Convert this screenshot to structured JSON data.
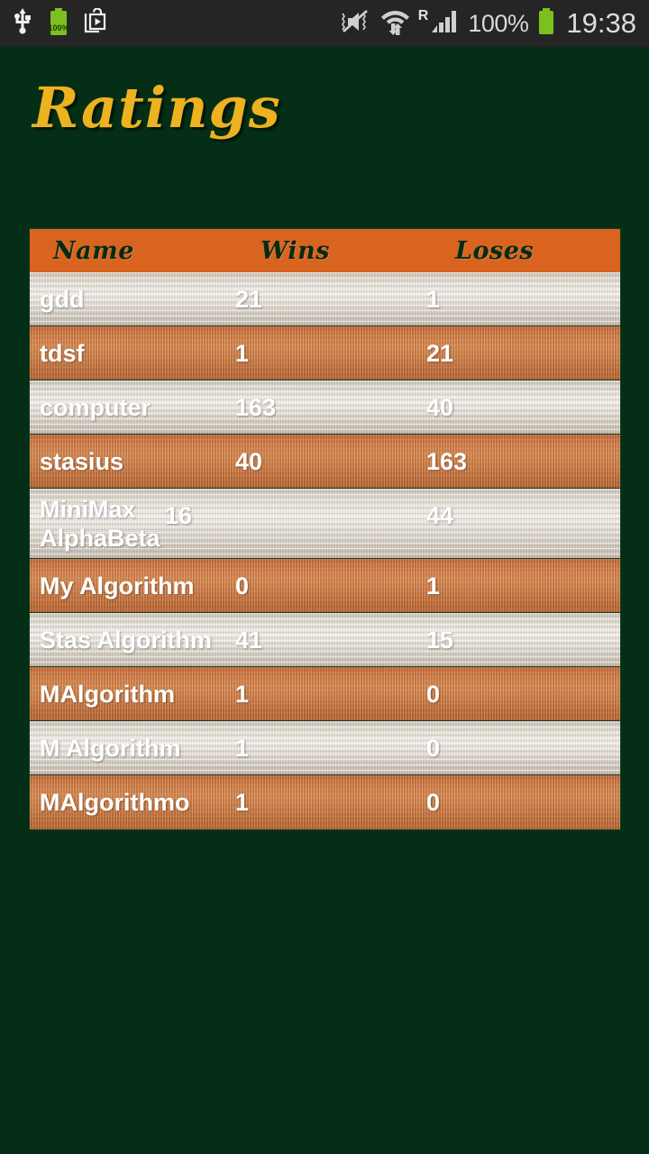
{
  "status_bar": {
    "left_icons": [
      "usb-icon",
      "battery-charging-icon",
      "play-store-icon"
    ],
    "battery_badge": "100%",
    "right_icons": [
      "mute-vibrate-off-icon",
      "wifi-data-transfer-icon",
      "roaming-icon",
      "signal-bars-icon",
      "battery-icon"
    ],
    "roaming_label": "R",
    "battery_percent": "100%",
    "time": "19:38",
    "background": "#252525"
  },
  "app": {
    "title": "Ratings",
    "title_color": "#ECB21F",
    "background_color": "#042F16"
  },
  "table": {
    "header_background": "#D8641F",
    "header_text_color": "#052B14",
    "row_light_color": "#E0DBD2",
    "row_orange_color": "#CD7C45",
    "columns": [
      "Name",
      "Wins",
      "Loses"
    ],
    "rows": [
      {
        "name": "gdd",
        "wins": "21",
        "loses": "1",
        "style": "light"
      },
      {
        "name": "tdsf",
        "wins": "1",
        "loses": "21",
        "style": "orange"
      },
      {
        "name": "computer",
        "wins": "163",
        "loses": "40",
        "style": "light"
      },
      {
        "name": "stasius",
        "wins": "40",
        "loses": "163",
        "style": "orange"
      },
      {
        "name": "MiniMax AlphaBeta",
        "wins": "16",
        "loses": "44",
        "style": "light"
      },
      {
        "name": "My Algorithm",
        "wins": "0",
        "loses": "1",
        "style": "orange"
      },
      {
        "name": "Stas Algorithm",
        "wins": "41",
        "loses": "15",
        "style": "light"
      },
      {
        "name": "MAlgorithm",
        "wins": "1",
        "loses": "0",
        "style": "orange"
      },
      {
        "name": "M Algorithm",
        "wins": "1",
        "loses": "0",
        "style": "light"
      },
      {
        "name": "MAlgorithmo",
        "wins": "1",
        "loses": "0",
        "style": "orange"
      }
    ]
  }
}
